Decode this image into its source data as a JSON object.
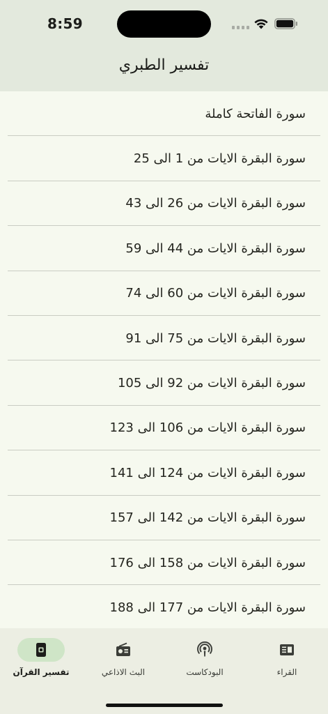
{
  "status": {
    "time": "8:59"
  },
  "header": {
    "title": "تفسير الطبري"
  },
  "list": {
    "items": [
      "سورة الفاتحة كاملة",
      "سورة البقرة الايات من 1 الى 25",
      "سورة البقرة الايات من 26 الى 43",
      "سورة البقرة الايات من 44 الى 59",
      "سورة البقرة الايات من 60 الى 74",
      "سورة البقرة الايات من 75 الى 91",
      "سورة البقرة الايات من 92 الى 105",
      "سورة البقرة الايات من 106 الى 123",
      "سورة البقرة الايات من 124 الى 141",
      "سورة البقرة الايات من 142 الى 157",
      "سورة البقرة الايات من 158 الى 176",
      "سورة البقرة الايات من 177 الى 188"
    ]
  },
  "tabbar": {
    "tabs": [
      {
        "label": "تفسير القرآن",
        "icon": "book-icon",
        "active": true
      },
      {
        "label": "البث الاذاعي",
        "icon": "radio-icon",
        "active": false
      },
      {
        "label": "البودكاست",
        "icon": "podcast-icon",
        "active": false
      },
      {
        "label": "القراء",
        "icon": "reciters-icon",
        "active": false
      }
    ]
  },
  "colors": {
    "header_bg": "#e3e9dd",
    "page_bg": "#f6f9ef",
    "tabbar_bg": "#eceee3",
    "active_pill": "#cfe5c7",
    "divider": "#c9ccc3"
  }
}
